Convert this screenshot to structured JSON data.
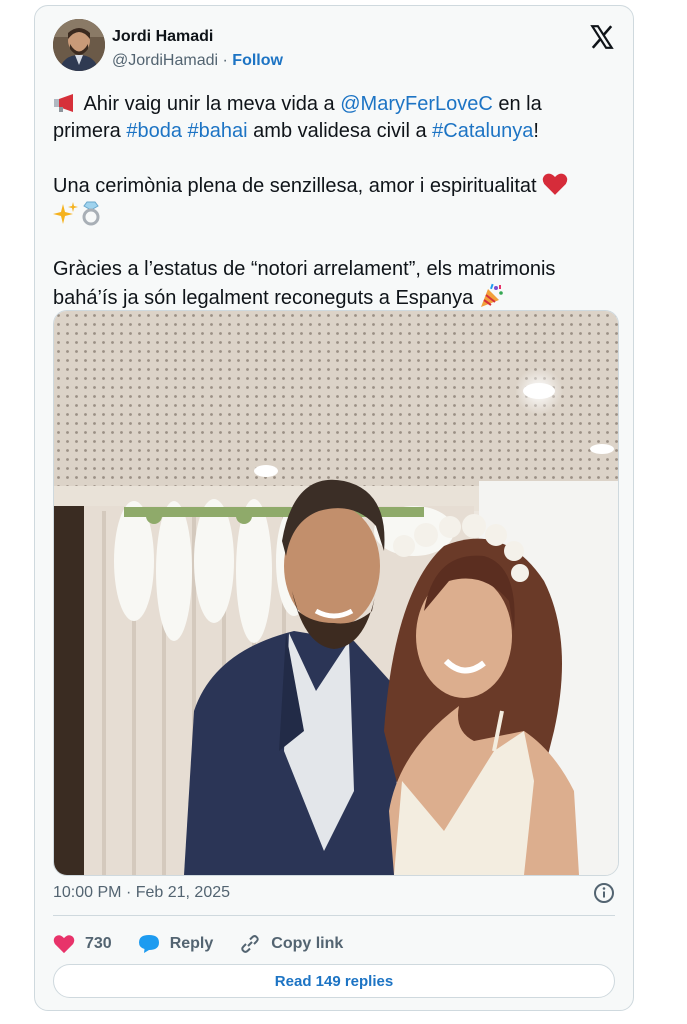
{
  "author": {
    "name": "Jordi Hamadi",
    "handle": "@JordiHamadi",
    "separator": "·",
    "follow_label": "Follow"
  },
  "icons": {
    "platform": "x-logo-icon",
    "megaphone": "megaphone-icon",
    "heart": "heart-icon",
    "sparkles": "sparkles-icon",
    "ring": "ring-icon",
    "party": "party-popper-icon",
    "info": "info-icon",
    "like": "heart-icon",
    "reply": "speech-bubble-icon",
    "copy": "link-icon"
  },
  "tweet": {
    "line1_pre": " Ahir vaig unir la meva vida a ",
    "mention": "@MaryFerLoveC",
    "line1_post": " en la",
    "line2_pre": "primera ",
    "tag_boda": "#boda",
    "tag_bahai": "#bahai",
    "line2_mid": " amb validesa civil a ",
    "tag_catalunya": "#Catalunya",
    "line2_post": "!",
    "para2": "Una cerimònia plena de senzillesa, amor i espiritualitat ",
    "para3_line1": "Gràcies a l’estatus de “notori arrelament”, els matrimonis",
    "para3_line2": "bahá’ís ja són legalment reconeguts a Espanya "
  },
  "meta": {
    "time": "10:00 PM",
    "separator": "·",
    "date": "Feb 21, 2025"
  },
  "actions": {
    "like_count": "730",
    "reply_label": "Reply",
    "copy_label": "Copy link"
  },
  "read_replies": "Read 149 replies",
  "colors": {
    "link": "#1d74c4",
    "heart": "#e8336a",
    "reply": "#1d9bf0",
    "card_bg": "#f7f9f9",
    "border": "#cfd9de"
  }
}
